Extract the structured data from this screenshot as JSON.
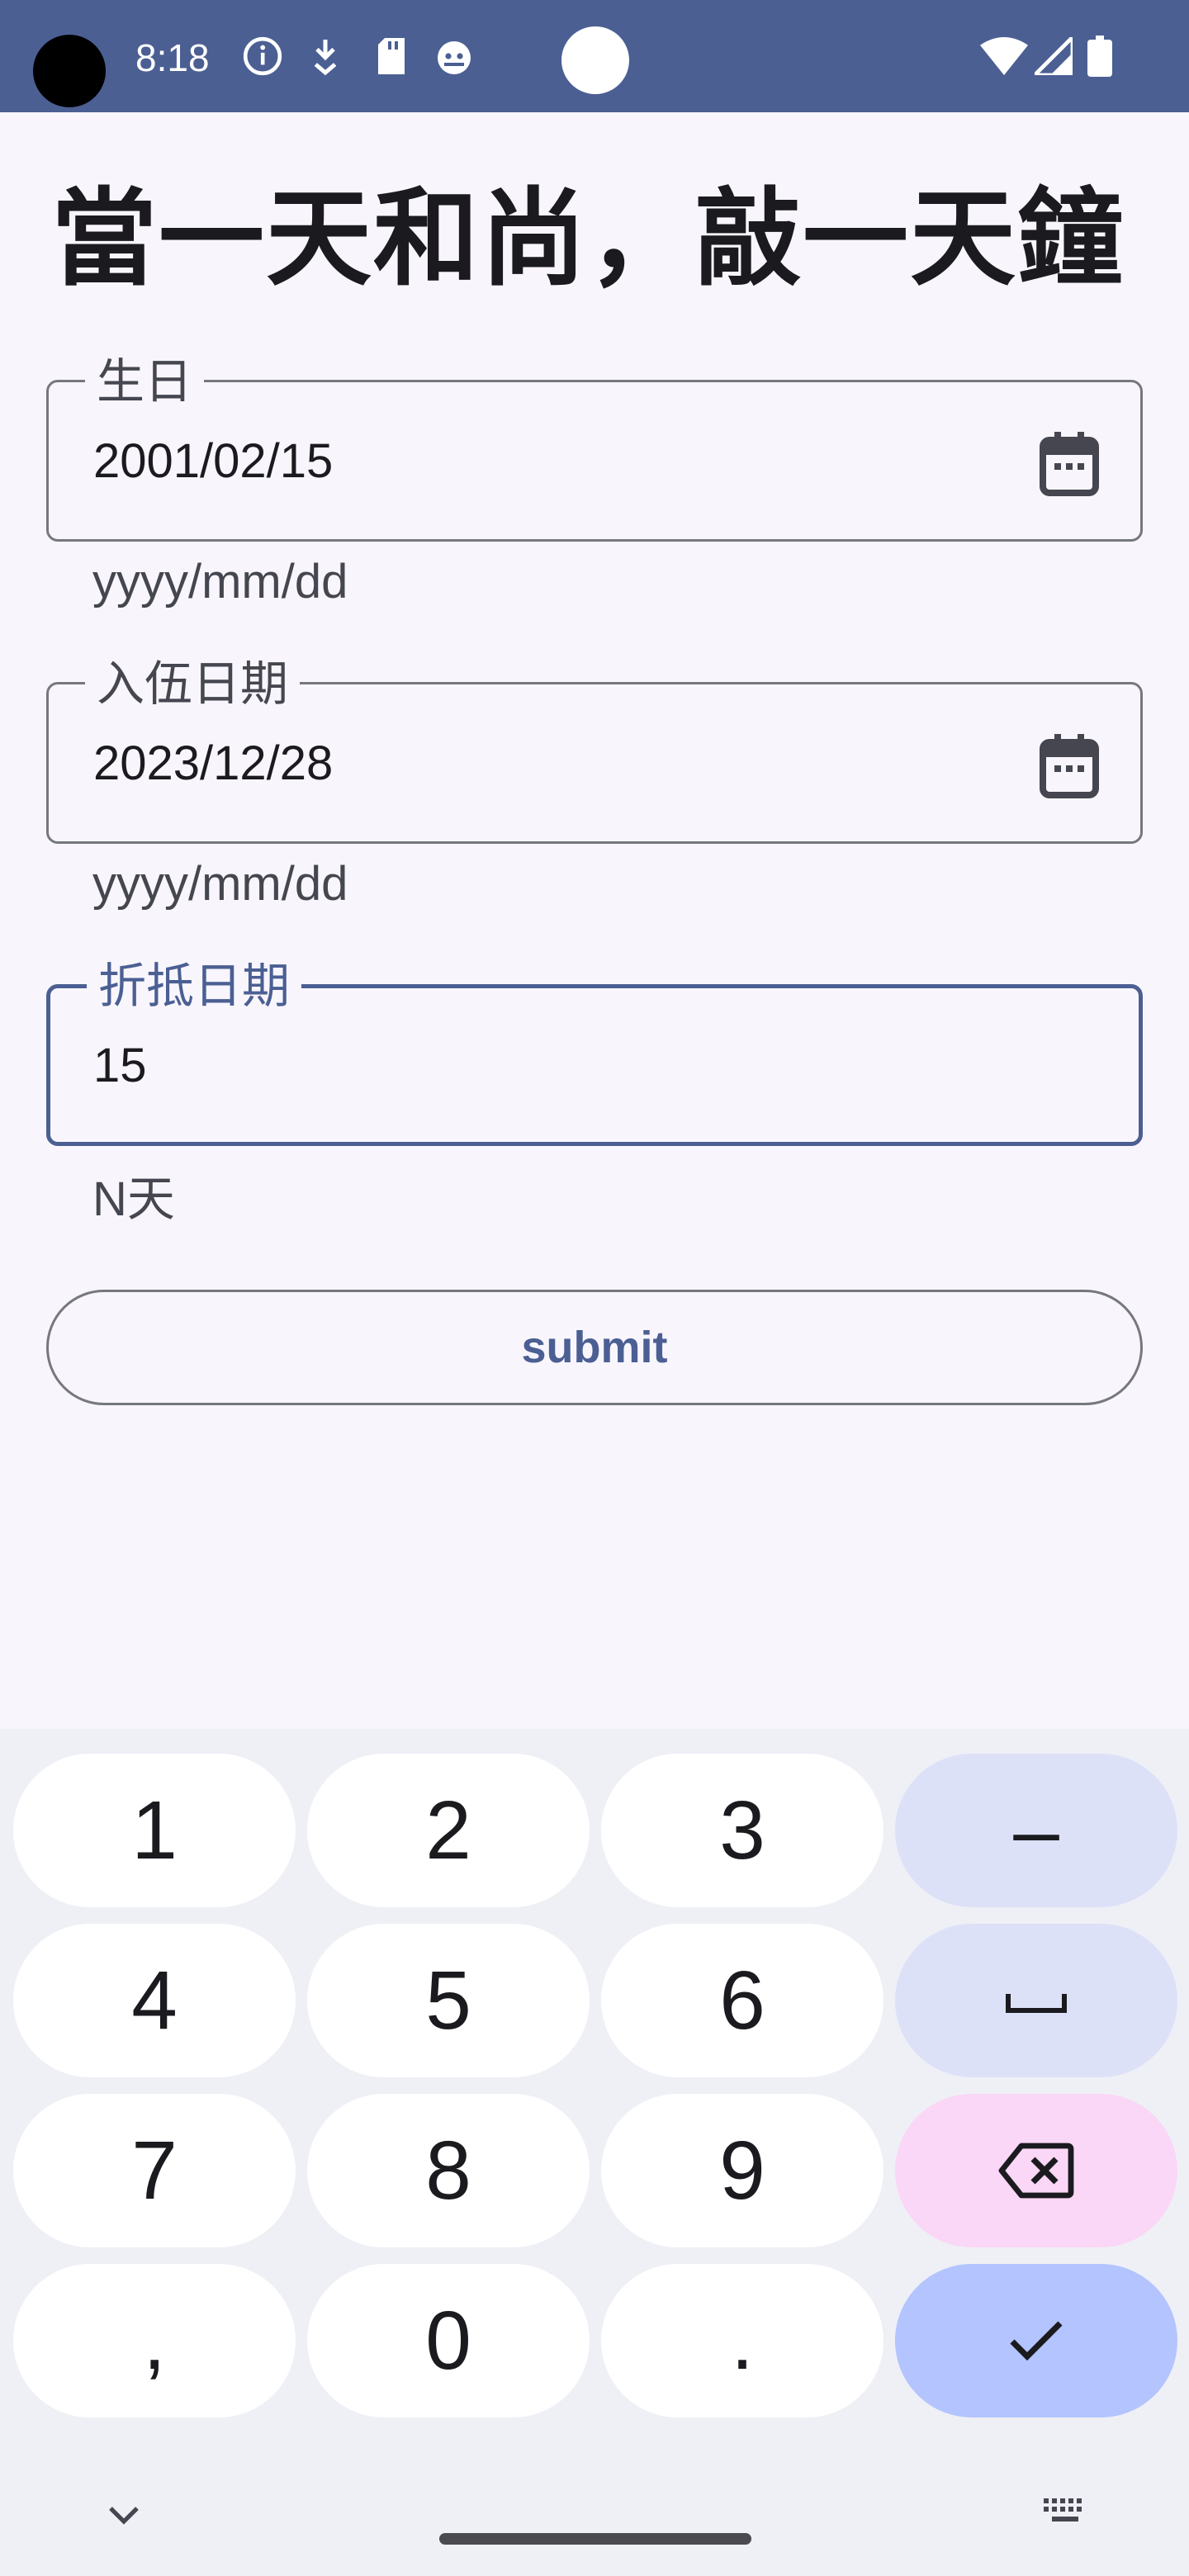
{
  "status_bar": {
    "time": "8:18",
    "icons": [
      "info-icon",
      "download-icon",
      "sd-card-icon",
      "android-debug-icon",
      "wifi-icon",
      "signal-icon",
      "battery-icon"
    ],
    "background": "#4b5f93"
  },
  "title": "當一天和尚，敲一天鐘",
  "fields": {
    "birthday": {
      "label": "生日",
      "value": "2001/02/15",
      "helper": "yyyy/mm/dd",
      "icon": "calendar-icon"
    },
    "enlist": {
      "label": "入伍日期",
      "value": "2023/12/28",
      "helper": "yyyy/mm/dd",
      "icon": "calendar-icon"
    },
    "offset": {
      "label": "折抵日期",
      "value": "15",
      "helper": "N天",
      "focused": true
    }
  },
  "submit": {
    "label": "submit"
  },
  "keyboard": {
    "keys": [
      "1",
      "2",
      "3",
      "–",
      "4",
      "5",
      "6",
      "␣",
      "7",
      "8",
      "9",
      "⌫",
      ",",
      "0",
      ".",
      "✓"
    ],
    "bottom_icons": [
      "chevron-down-icon",
      "keyboard-icon"
    ]
  },
  "colors": {
    "primary": "#4b5f93",
    "surface": "#f8f6fc",
    "outline": "#76777f",
    "key_fn": "#dde1f7",
    "key_delete": "#fad7f6",
    "key_confirm": "#b3c4ff"
  }
}
